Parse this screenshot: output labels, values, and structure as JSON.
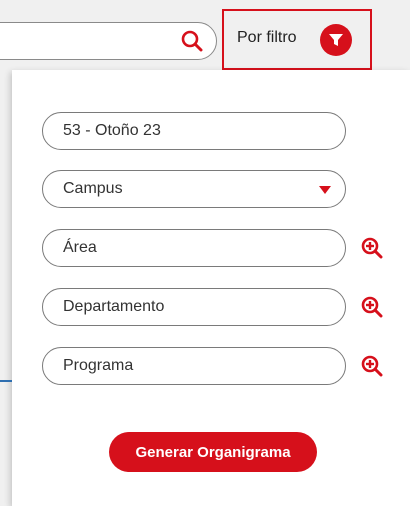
{
  "search": {
    "placeholder": "",
    "icon": "search-icon"
  },
  "filter_toggle": {
    "label": "Por filtro",
    "icon": "filter-icon",
    "accent": "#d6101b"
  },
  "form": {
    "period_value": "53 - Otoño 23",
    "campus_value": "Campus",
    "area_value": "Área",
    "department_value": "Departamento",
    "program_value": "Programa",
    "zoom_icon": "zoom-in-icon"
  },
  "actions": {
    "generate_label": "Generar Organigrama"
  }
}
